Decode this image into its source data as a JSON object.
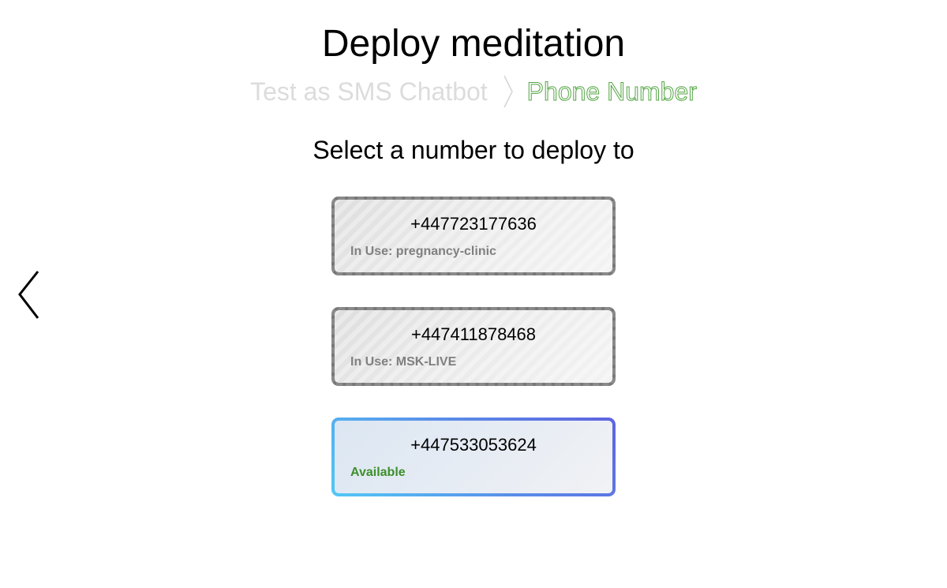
{
  "page": {
    "title": "Deploy meditation",
    "subtitle": "Select a number to deploy to"
  },
  "breadcrumb": {
    "previous": "Test as SMS Chatbot",
    "separator_icon": "chevron-right-icon",
    "current": "Phone Number"
  },
  "navigation": {
    "back_icon": "chevron-left-icon"
  },
  "numbers": [
    {
      "number": "+447723177636",
      "status": "In Use: pregnancy-clinic",
      "state": "in-use"
    },
    {
      "number": "+447411878468",
      "status": "In Use: MSK-LIVE",
      "state": "in-use"
    },
    {
      "number": "+447533053624",
      "status": "Available",
      "state": "available"
    }
  ],
  "colors": {
    "breadcrumb_current": "#54a544",
    "breadcrumb_previous": "#dcdcdc",
    "available_status": "#3d8f2b",
    "in_use_status": "#808080",
    "available_border_start": "#52c8f5",
    "available_border_end": "#5f63e0"
  }
}
